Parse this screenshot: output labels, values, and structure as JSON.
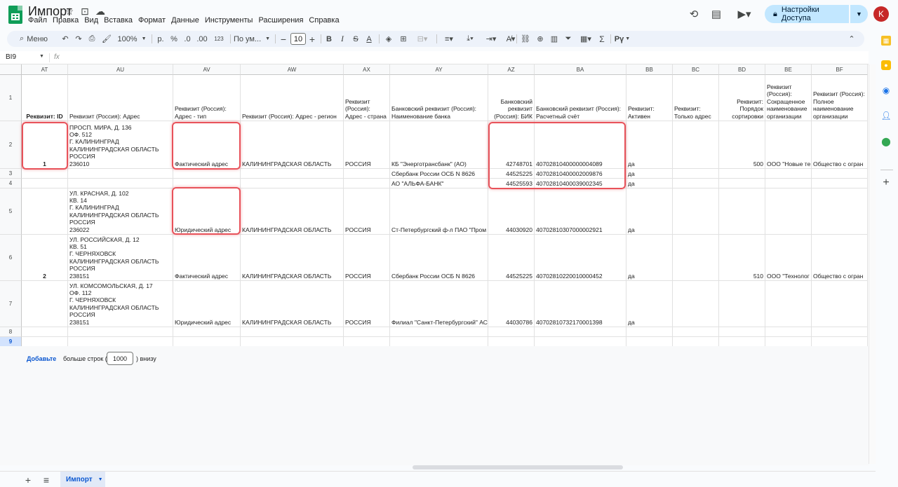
{
  "doc": {
    "title": "Импорт",
    "menu": [
      "Файл",
      "Правка",
      "Вид",
      "Вставка",
      "Формат",
      "Данные",
      "Инструменты",
      "Расширения",
      "Справка"
    ],
    "share_label": "Настройки Доступа",
    "avatar_letter": "K"
  },
  "toolbar": {
    "menu_label": "Меню",
    "zoom": "100%",
    "currency": "р.",
    "percent": "%",
    "dec_decrease": ".0",
    "dec_increase": ".00",
    "format_123": "123",
    "font": "По ум...",
    "font_size": "10",
    "bold": "B",
    "italic": "I",
    "strike": "S",
    "text_color": "A",
    "sigma": "Σ",
    "input_lang": "Рү"
  },
  "formula_bar": {
    "name_box": "BI9",
    "fx": "fx"
  },
  "columns": [
    "AT",
    "AU",
    "AV",
    "AW",
    "AX",
    "AY",
    "AZ",
    "BA",
    "BB",
    "BC",
    "BD",
    "BE",
    "BF"
  ],
  "rows": [
    "1",
    "2",
    "3",
    "4",
    "5",
    "6",
    "7",
    "8",
    "9"
  ],
  "headers": {
    "AT": "Реквизит: ID",
    "AU": "Реквизит (Россия): Адрес",
    "AV": "Реквизит (Россия):\nАдрес - тип",
    "AW": "Реквизит (Россия): Адрес - регион",
    "AX": "Реквизит\n(Россия):\nАдрес - страна",
    "AY": "Банковский реквизит (Россия):\nНаименование банка",
    "AZ": "Банковский\nреквизит\n(Россия): БИК",
    "BA": "Банковский реквизит (Россия):\nРасчетный счёт",
    "BB": "Реквизит:\nАктивен",
    "BC": "Реквизит:\nТолько адрес",
    "BD": "Реквизит:\nПорядок\nсортировки",
    "BE": "Реквизит\n(Россия):\nСокращенное\nнаименование\nорганизации",
    "BF": "Реквизит (Россия):\nПолное\nнаименование\nорганизации"
  },
  "data": {
    "r2": {
      "AT": "1",
      "AU": "ПРОСП. МИРА, Д. 136\nОФ. 512\nГ. КАЛИНИНГРАД\nКАЛИНИНГРАДСКАЯ ОБЛАСТЬ\nРОССИЯ\n236010",
      "AV": "Фактический адрес",
      "AW": "КАЛИНИНГРАДСКАЯ ОБЛАСТЬ",
      "AX": "РОССИЯ",
      "AY": "КБ \"Энерготрансбанк\" (АО)",
      "AZ": "42748701",
      "BA": "40702810400000004089",
      "BB": "да",
      "BD": "500",
      "BE": "ООО \"Новые те",
      "BF": "Общество с огран"
    },
    "r3": {
      "AY": "Сбербанк России ОСБ N 8626",
      "AZ": "44525225",
      "BA": "40702810400002009876",
      "BB": "да"
    },
    "r4": {
      "AY": "АО \"АЛЬФА-БАНК\"",
      "AZ": "44525593",
      "BA": "40702810400039002345",
      "BB": "да"
    },
    "r5": {
      "AU": "УЛ. КРАСНАЯ, Д. 102\nКВ. 14\nГ. КАЛИНИНГРАД\nКАЛИНИНГРАДСКАЯ ОБЛАСТЬ\nРОССИЯ\n236022",
      "AV": "Юридический адрес",
      "AW": "КАЛИНИНГРАДСКАЯ ОБЛАСТЬ",
      "AX": "РОССИЯ",
      "AY": "Ст-Петербургский ф-л ПАО \"Пром",
      "AZ": "44030920",
      "BA": "40702810307000002921",
      "BB": "да"
    },
    "r6": {
      "AT": "2",
      "AU": "УЛ. РОССИЙСКАЯ, Д. 12\nКВ. 51\nГ. ЧЕРНЯХОВСК\nКАЛИНИНГРАДСКАЯ ОБЛАСТЬ\nРОССИЯ\n238151",
      "AV": "Фактический адрес",
      "AW": "КАЛИНИНГРАДСКАЯ ОБЛАСТЬ",
      "AX": "РОССИЯ",
      "AY": "Сбербанк России ОСБ N 8626",
      "AZ": "44525225",
      "BA": "40702810220010000452",
      "BB": "да",
      "BD": "510",
      "BE": "ООО \"Технолог",
      "BF": "Общество с огран"
    },
    "r7": {
      "AU": "УЛ. КОМСОМОЛЬСКАЯ, Д. 17\nОФ. 112\nГ. ЧЕРНЯХОВСК\nКАЛИНИНГРАДСКАЯ ОБЛАСТЬ\nРОССИЯ\n238151",
      "AV": "Юридический адрес",
      "AW": "КАЛИНИНГРАДСКАЯ ОБЛАСТЬ",
      "AX": "РОССИЯ",
      "AY": "Филиал \"Санкт-Петербургский\" АС",
      "AZ": "44030786",
      "BA": "40702810732170001398",
      "BB": "да"
    }
  },
  "add_rows": {
    "link": "Добавьте",
    "text_before": "больше строк (",
    "count": "1000",
    "text_after": ") внизу"
  },
  "sheet_tab": "Импорт",
  "colors": {
    "accent": "#0b57d0",
    "share_bg": "#c2e7ff",
    "highlight": "#e8525a",
    "sheets_green": "#0f9d58",
    "avatar": "#c62828"
  }
}
